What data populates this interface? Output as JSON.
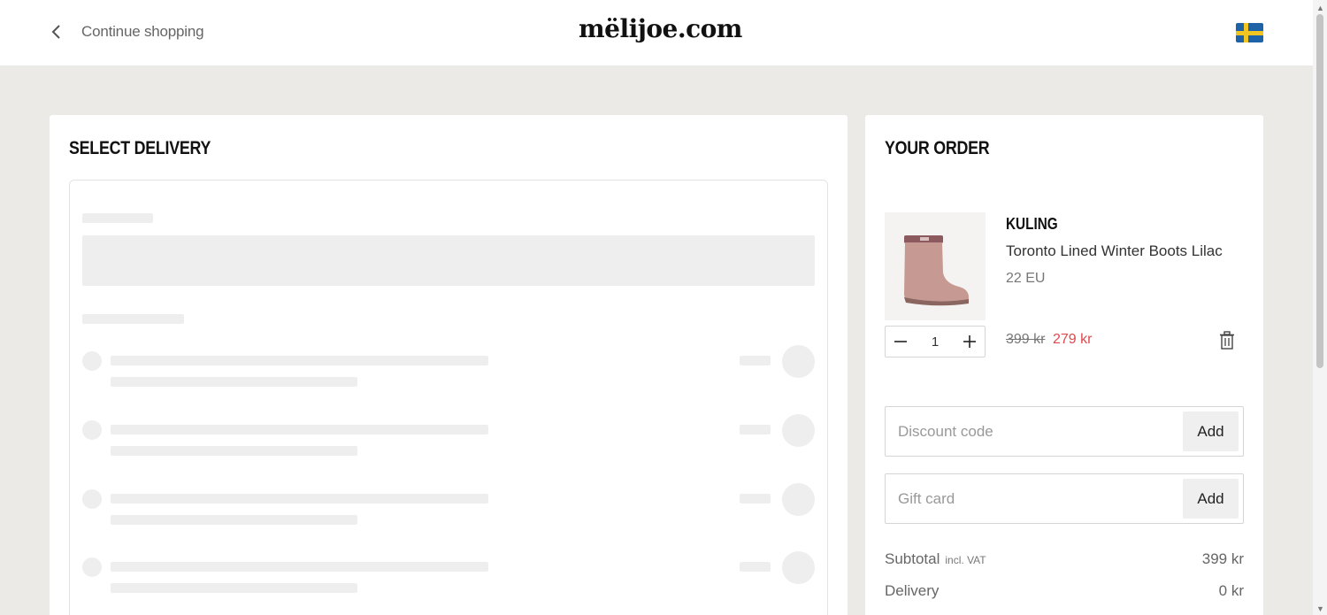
{
  "header": {
    "back_label": "Continue shopping",
    "logo": "mëlijoe.com",
    "flag": "sweden-flag-icon"
  },
  "delivery": {
    "heading": "SELECT DELIVERY"
  },
  "order": {
    "heading": "YOUR ORDER",
    "item": {
      "brand": "KULING",
      "name": "Toronto Lined Winter Boots Lilac",
      "size": "22 EU",
      "quantity": "1",
      "old_price": "399 kr",
      "new_price": "279 kr"
    },
    "discount": {
      "placeholder": "Discount code",
      "button": "Add"
    },
    "giftcard": {
      "placeholder": "Gift card",
      "button": "Add"
    },
    "summary": {
      "subtotal_label": "Subtotal",
      "subtotal_note": "incl. VAT",
      "subtotal_value": "399 kr",
      "delivery_label": "Delivery",
      "delivery_value": "0 kr"
    }
  },
  "colors": {
    "background": "#ebeae6",
    "sale_price": "#e0484c",
    "skeleton": "#eeeeee"
  }
}
